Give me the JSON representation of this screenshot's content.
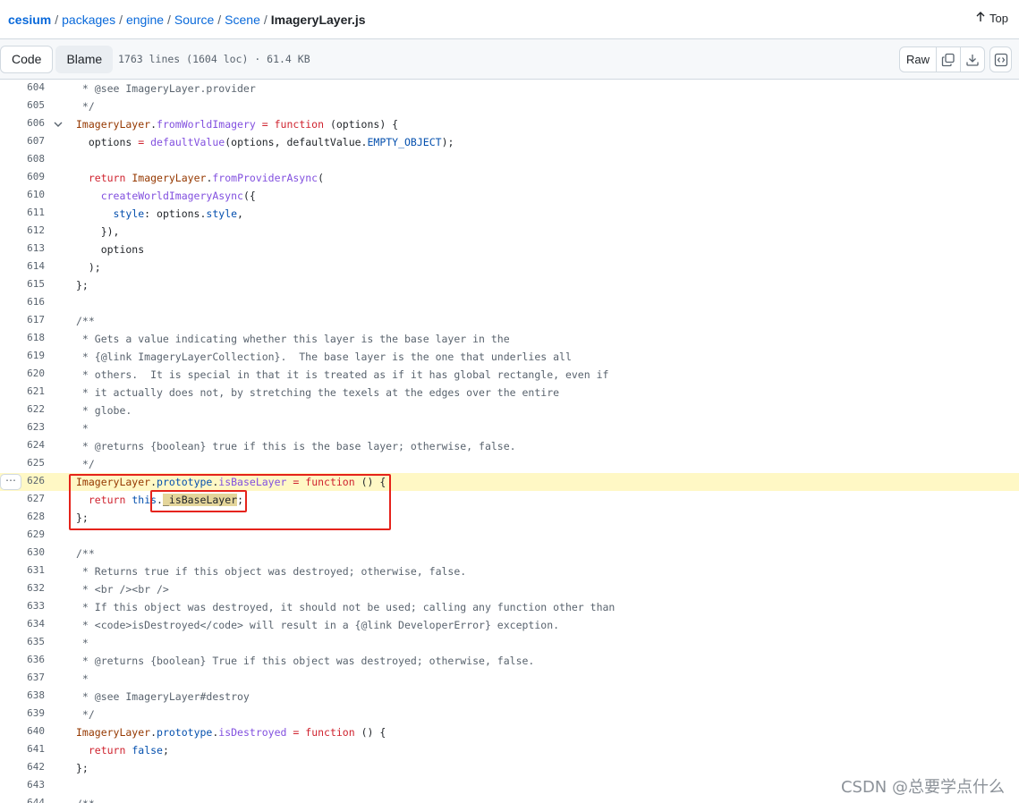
{
  "breadcrumb": {
    "root": "cesium",
    "parts": [
      "packages",
      "engine",
      "Source",
      "Scene"
    ],
    "file": "ImageryLayer.js",
    "separator": "/"
  },
  "top_label": "Top",
  "toolbar": {
    "code_tab": "Code",
    "blame_tab": "Blame",
    "file_info": "1763 lines (1604 loc) · 61.4 KB",
    "raw_label": "Raw"
  },
  "line_numbers": [
    "604",
    "605",
    "606",
    "607",
    "608",
    "609",
    "610",
    "611",
    "612",
    "613",
    "614",
    "615",
    "616",
    "617",
    "618",
    "619",
    "620",
    "621",
    "622",
    "623",
    "624",
    "625",
    "626",
    "627",
    "628",
    "629",
    "630",
    "631",
    "632",
    "633",
    "634",
    "635",
    "636",
    "637",
    "638",
    "639",
    "640",
    "641",
    "642",
    "643",
    "644"
  ],
  "highlighted_line": "626",
  "selected_text": "_isBaseLayer",
  "watermark": "CSDN @总要学点什么",
  "colors": {
    "link": "#0969da",
    "keyword": "#cf222e",
    "function": "#8250df",
    "comment": "#59636e",
    "property": "#0550ae",
    "highlight_line": "#fff8c5",
    "annotation_box": "#e5231b"
  },
  "icons": [
    "arrow-up-icon",
    "copy-icon",
    "download-icon",
    "chevron-down-icon",
    "symbols-icon",
    "kebab-icon"
  ]
}
